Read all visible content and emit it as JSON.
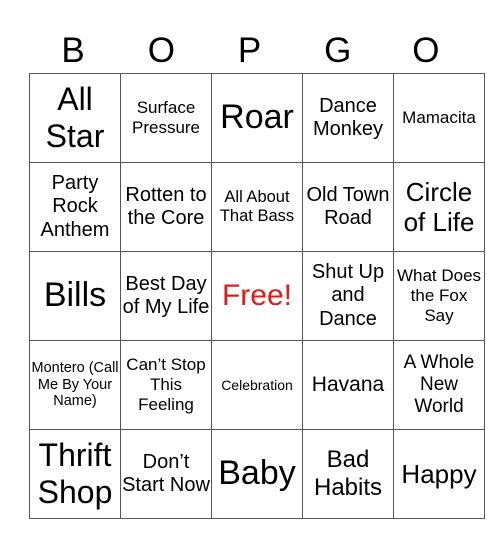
{
  "card": {
    "header": [
      "B",
      "O",
      "P",
      "G",
      "O"
    ],
    "free_color": "#e01b1b",
    "rows": [
      [
        {
          "text": "All Star",
          "size": 32
        },
        {
          "text": "Surface Pressure",
          "size": 17
        },
        {
          "text": "Roar",
          "size": 34
        },
        {
          "text": "Dance Monkey",
          "size": 20
        },
        {
          "text": "Mamacita",
          "size": 17
        }
      ],
      [
        {
          "text": "Party Rock Anthem",
          "size": 20
        },
        {
          "text": "Rotten to the Core",
          "size": 20
        },
        {
          "text": "All About That Bass",
          "size": 16.5
        },
        {
          "text": "Old Town Road",
          "size": 20
        },
        {
          "text": "Circle of Life",
          "size": 26
        }
      ],
      [
        {
          "text": "Bills",
          "size": 34
        },
        {
          "text": "Best Day of My Life",
          "size": 20
        },
        {
          "text": "Free!",
          "size": 30,
          "free": true
        },
        {
          "text": "Shut Up and Dance",
          "size": 20
        },
        {
          "text": "What Does the Fox Say",
          "size": 17
        }
      ],
      [
        {
          "text": "Montero (Call Me By Your Name)",
          "size": 14.5
        },
        {
          "text": "Can’t Stop This Feeling",
          "size": 17
        },
        {
          "text": "Celebration",
          "size": 14
        },
        {
          "text": "Havana",
          "size": 21
        },
        {
          "text": "A Whole New World",
          "size": 19
        }
      ],
      [
        {
          "text": "Thrift Shop",
          "size": 32
        },
        {
          "text": "Don’t Start Now",
          "size": 20
        },
        {
          "text": "Baby",
          "size": 34
        },
        {
          "text": "Bad Habits",
          "size": 24
        },
        {
          "text": "Happy",
          "size": 26
        }
      ]
    ]
  }
}
